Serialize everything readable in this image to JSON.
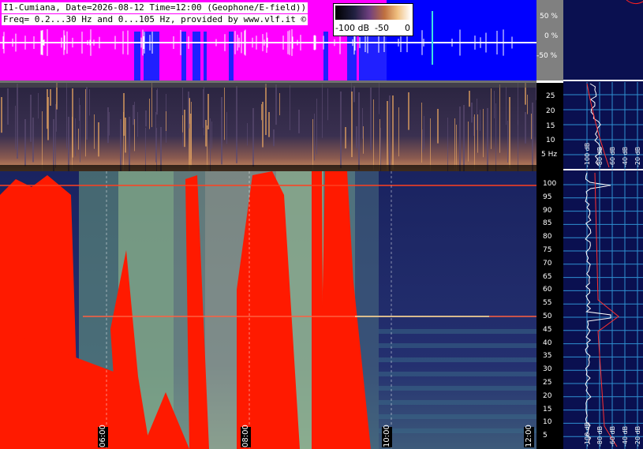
{
  "header": {
    "line1": "I1-Cumiana, Date=2026-08-12 Time=12:00 (Geophone/E-field))",
    "line2": "Freq= 0.2...30 Hz and 0...105 Hz, provided by www.vlf.it ©"
  },
  "scale": {
    "min_label": "-100 dB",
    "mid_label": "-50",
    "max_label": "0"
  },
  "colors": {
    "waveform_bg_pink": "#ff00ff",
    "waveform_bg_blue": "#0000ff",
    "spectro_bg": "#1e2a5a",
    "saturated": "#ff1a00",
    "side_bg": "#0a1050",
    "side_grid": "#2f8fd0"
  },
  "chart_data": [
    {
      "type": "line",
      "panel": "waveform",
      "ylabel_ticks": [
        "50 %",
        "0 %",
        "-50 %"
      ],
      "y_values": [
        50,
        0,
        -50
      ]
    },
    {
      "type": "heatmap",
      "panel": "geophone-spectrogram",
      "y_ticks": [
        "25",
        "20",
        "15",
        "10",
        "5 Hz"
      ],
      "ylim": [
        0.2,
        30
      ]
    },
    {
      "type": "heatmap",
      "panel": "efield-spectrogram",
      "y_ticks": [
        "100",
        "95",
        "90",
        "85",
        "80",
        "75",
        "70",
        "65",
        "60",
        "55",
        "50",
        "45",
        "40",
        "35",
        "30",
        "25",
        "20",
        "15",
        "10",
        "5"
      ],
      "ylim": [
        0,
        105
      ],
      "x_ticks": [
        "06:00",
        "08:00",
        "10:00",
        "12:00"
      ],
      "notable_lines_hz": [
        50,
        100
      ]
    },
    {
      "type": "line",
      "panel": "geophone-side-spectrum",
      "x_ticks": [
        "-100 dB",
        "-80 dB",
        "-60 dB",
        "-40 dB",
        "-20 dB"
      ]
    },
    {
      "type": "line",
      "panel": "efield-side-spectrum",
      "x_ticks": [
        "-100 dB",
        "-80 dB",
        "-60 dB",
        "-40 dB",
        "-20 dB"
      ]
    }
  ]
}
